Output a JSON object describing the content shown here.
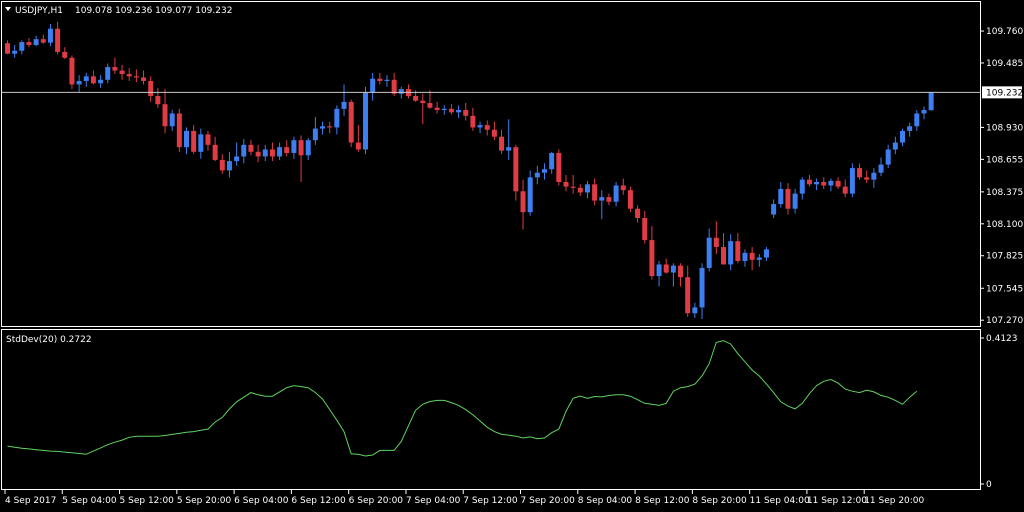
{
  "colors": {
    "background": "#000000",
    "frame": "#ffffff",
    "bull": "#3d7ff0",
    "bear": "#e03c46",
    "indicator": "#5fd35f",
    "price_line": "#c8c8c8",
    "text": "#ffffff"
  },
  "header": {
    "arrow_icon": "triangle-down-icon",
    "symbol": "USDJPY,H1",
    "ohlc": "109.078 109.236 109.077 109.232"
  },
  "indicator_header": {
    "label": "StdDev(20) 0.2722"
  },
  "chart_data": [
    {
      "type": "candlestick",
      "title": "USDJPY,H1",
      "ylim": [
        107.22,
        110.01
      ],
      "y_ticks": [
        "109.760",
        "109.485",
        "109.232",
        "108.930",
        "108.655",
        "108.375",
        "108.100",
        "107.825",
        "107.545",
        "107.270"
      ],
      "current_price": "109.232",
      "current_price_value": 109.232,
      "x_ticks": [
        "4 Sep 2017",
        "5 Sep 04:00",
        "5 Sep 12:00",
        "5 Sep 20:00",
        "6 Sep 04:00",
        "6 Sep 12:00",
        "6 Sep 20:00",
        "7 Sep 04:00",
        "7 Sep 12:00",
        "7 Sep 20:00",
        "8 Sep 04:00",
        "8 Sep 12:00",
        "8 Sep 20:00",
        "11 Sep 04:00",
        "11 Sep 12:00",
        "11 Sep 20:00"
      ],
      "candles": [
        [
          109.655,
          109.68,
          109.56,
          109.565
        ],
        [
          109.565,
          109.64,
          109.53,
          109.59
        ],
        [
          109.59,
          109.68,
          109.56,
          109.665
        ],
        [
          109.665,
          109.7,
          109.62,
          109.64
        ],
        [
          109.64,
          109.72,
          109.63,
          109.69
        ],
        [
          109.69,
          109.73,
          109.65,
          109.66
        ],
        [
          109.66,
          109.82,
          109.63,
          109.78
        ],
        [
          109.78,
          109.84,
          109.56,
          109.58
        ],
        [
          109.58,
          109.62,
          109.52,
          109.53
        ],
        [
          109.53,
          109.55,
          109.26,
          109.3
        ],
        [
          109.3,
          109.38,
          109.23,
          109.33
        ],
        [
          109.33,
          109.4,
          109.28,
          109.37
        ],
        [
          109.37,
          109.42,
          109.3,
          109.31
        ],
        [
          109.31,
          109.38,
          109.27,
          109.34
        ],
        [
          109.34,
          109.48,
          109.31,
          109.45
        ],
        [
          109.45,
          109.53,
          109.39,
          109.42
        ],
        [
          109.42,
          109.47,
          109.34,
          109.39
        ],
        [
          109.39,
          109.44,
          109.33,
          109.37
        ],
        [
          109.37,
          109.43,
          109.32,
          109.36
        ],
        [
          109.36,
          109.42,
          109.3,
          109.33
        ],
        [
          109.33,
          109.37,
          109.15,
          109.2
        ],
        [
          109.2,
          109.27,
          109.1,
          109.13
        ],
        [
          109.13,
          109.26,
          108.88,
          108.94
        ],
        [
          108.94,
          109.08,
          108.9,
          109.05
        ],
        [
          109.05,
          109.09,
          108.72,
          108.76
        ],
        [
          108.76,
          108.93,
          108.7,
          108.9
        ],
        [
          108.9,
          108.95,
          108.7,
          108.72
        ],
        [
          108.72,
          108.92,
          108.66,
          108.87
        ],
        [
          108.87,
          108.9,
          108.73,
          108.78
        ],
        [
          108.78,
          108.85,
          108.64,
          108.65
        ],
        [
          108.65,
          108.7,
          108.53,
          108.56
        ],
        [
          108.56,
          108.72,
          108.5,
          108.64
        ],
        [
          108.64,
          108.8,
          108.6,
          108.68
        ],
        [
          108.68,
          108.83,
          108.62,
          108.78
        ],
        [
          108.78,
          108.82,
          108.69,
          108.72
        ],
        [
          108.72,
          108.78,
          108.63,
          108.68
        ],
        [
          108.68,
          108.78,
          108.64,
          108.74
        ],
        [
          108.74,
          108.8,
          108.64,
          108.68
        ],
        [
          108.68,
          108.8,
          108.65,
          108.76
        ],
        [
          108.76,
          108.82,
          108.68,
          108.71
        ],
        [
          108.71,
          108.85,
          108.66,
          108.82
        ],
        [
          108.82,
          108.86,
          108.46,
          108.69
        ],
        [
          108.69,
          108.84,
          108.65,
          108.82
        ],
        [
          108.82,
          109.02,
          108.78,
          108.92
        ],
        [
          108.92,
          108.98,
          108.87,
          108.94
        ],
        [
          108.94,
          108.98,
          108.88,
          108.93
        ],
        [
          108.93,
          109.12,
          108.87,
          109.09
        ],
        [
          109.09,
          109.3,
          109.03,
          109.15
        ],
        [
          109.15,
          109.17,
          108.76,
          108.8
        ],
        [
          108.8,
          108.95,
          108.72,
          108.74
        ],
        [
          108.74,
          109.28,
          108.7,
          109.23
        ],
        [
          109.23,
          109.4,
          109.16,
          109.35
        ],
        [
          109.35,
          109.4,
          109.3,
          109.33
        ],
        [
          109.33,
          109.38,
          109.28,
          109.34
        ],
        [
          109.34,
          109.4,
          109.2,
          109.22
        ],
        [
          109.22,
          109.28,
          109.18,
          109.26
        ],
        [
          109.26,
          109.3,
          109.18,
          109.2
        ],
        [
          109.2,
          109.25,
          109.15,
          109.16
        ],
        [
          109.16,
          109.22,
          108.96,
          109.14
        ],
        [
          109.14,
          109.25,
          109.09,
          109.1
        ],
        [
          109.1,
          109.15,
          109.05,
          109.08
        ],
        [
          109.08,
          109.12,
          109.04,
          109.09
        ],
        [
          109.09,
          109.13,
          109.04,
          109.06
        ],
        [
          109.06,
          109.12,
          109.01,
          109.08
        ],
        [
          109.08,
          109.14,
          108.99,
          109.03
        ],
        [
          109.03,
          109.1,
          108.9,
          108.93
        ],
        [
          108.93,
          108.98,
          108.88,
          108.95
        ],
        [
          108.95,
          108.99,
          108.86,
          108.91
        ],
        [
          108.91,
          108.98,
          108.82,
          108.85
        ],
        [
          108.85,
          108.91,
          108.7,
          108.73
        ],
        [
          108.73,
          109.0,
          108.65,
          108.76
        ],
        [
          108.76,
          108.78,
          108.3,
          108.38
        ],
        [
          108.38,
          108.48,
          108.05,
          108.2
        ],
        [
          108.2,
          108.56,
          108.17,
          108.5
        ],
        [
          108.5,
          108.6,
          108.44,
          108.54
        ],
        [
          108.54,
          108.62,
          108.48,
          108.57
        ],
        [
          108.57,
          108.72,
          108.53,
          108.71
        ],
        [
          108.71,
          108.74,
          108.43,
          108.46
        ],
        [
          108.46,
          108.52,
          108.38,
          108.42
        ],
        [
          108.42,
          108.52,
          108.36,
          108.41
        ],
        [
          108.41,
          108.44,
          108.34,
          108.37
        ],
        [
          108.37,
          108.47,
          108.32,
          108.44
        ],
        [
          108.44,
          108.49,
          108.26,
          108.3
        ],
        [
          108.3,
          108.39,
          108.14,
          108.33
        ],
        [
          108.33,
          108.36,
          108.26,
          108.29
        ],
        [
          108.29,
          108.46,
          108.25,
          108.43
        ],
        [
          108.43,
          108.49,
          108.35,
          108.39
        ],
        [
          108.39,
          108.42,
          108.2,
          108.23
        ],
        [
          108.23,
          108.26,
          108.11,
          108.15
        ],
        [
          108.15,
          108.21,
          107.93,
          107.96
        ],
        [
          107.96,
          108.08,
          107.62,
          107.65
        ],
        [
          107.65,
          107.78,
          107.56,
          107.75
        ],
        [
          107.75,
          107.8,
          107.67,
          107.68
        ],
        [
          107.68,
          107.76,
          107.56,
          107.74
        ],
        [
          107.74,
          107.76,
          107.56,
          107.64
        ],
        [
          107.64,
          107.74,
          107.3,
          107.33
        ],
        [
          107.33,
          107.42,
          107.29,
          107.38
        ],
        [
          107.38,
          107.76,
          107.28,
          107.72
        ],
        [
          107.72,
          108.06,
          107.69,
          107.98
        ],
        [
          107.98,
          108.12,
          107.84,
          107.9
        ],
        [
          107.9,
          108.02,
          107.75,
          107.75
        ],
        [
          107.75,
          108.01,
          107.7,
          107.95
        ],
        [
          107.95,
          108.02,
          107.76,
          107.78
        ],
        [
          107.78,
          107.88,
          107.73,
          107.85
        ],
        [
          107.85,
          107.9,
          107.7,
          107.79
        ],
        [
          107.79,
          107.84,
          107.73,
          107.81
        ],
        [
          107.81,
          107.9,
          107.78,
          107.88
        ],
        [
          108.18,
          108.31,
          108.15,
          108.27
        ],
        [
          108.27,
          108.46,
          108.24,
          108.4
        ],
        [
          108.4,
          108.45,
          108.18,
          108.23
        ],
        [
          108.23,
          108.4,
          108.19,
          108.36
        ],
        [
          108.36,
          108.5,
          108.31,
          108.48
        ],
        [
          108.48,
          108.52,
          108.42,
          108.44
        ],
        [
          108.44,
          108.49,
          108.39,
          108.46
        ],
        [
          108.46,
          108.5,
          108.4,
          108.43
        ],
        [
          108.43,
          108.49,
          108.38,
          108.47
        ],
        [
          108.47,
          108.5,
          108.4,
          108.42
        ],
        [
          108.42,
          108.48,
          108.33,
          108.36
        ],
        [
          108.36,
          108.62,
          108.33,
          108.58
        ],
        [
          108.58,
          108.62,
          108.48,
          108.5
        ],
        [
          108.5,
          108.56,
          108.45,
          108.48
        ],
        [
          108.48,
          108.58,
          108.41,
          108.54
        ],
        [
          108.54,
          108.67,
          108.51,
          108.61
        ],
        [
          108.61,
          108.78,
          108.58,
          108.74
        ],
        [
          108.74,
          108.85,
          108.7,
          108.8
        ],
        [
          108.8,
          108.92,
          108.77,
          108.9
        ],
        [
          108.9,
          108.97,
          108.85,
          108.94
        ],
        [
          108.94,
          109.08,
          108.9,
          109.05
        ],
        [
          109.05,
          109.11,
          109.0,
          109.08
        ],
        [
          109.078,
          109.236,
          109.077,
          109.232
        ]
      ]
    },
    {
      "type": "line",
      "title": "StdDev(20) 0.2722",
      "ylim": [
        0,
        0.4123
      ],
      "y_ticks": [
        "0.4123",
        "0"
      ],
      "series": [
        {
          "values": [
            0.107,
            0.104,
            0.101,
            0.099,
            0.097,
            0.095,
            0.093,
            0.092,
            0.09,
            0.088,
            0.086,
            0.084,
            0.093,
            0.102,
            0.111,
            0.118,
            0.124,
            0.132,
            0.135,
            0.135,
            0.135,
            0.135,
            0.137,
            0.14,
            0.143,
            0.146,
            0.148,
            0.152,
            0.155,
            0.175,
            0.188,
            0.212,
            0.232,
            0.245,
            0.258,
            0.252,
            0.248,
            0.248,
            0.26,
            0.272,
            0.278,
            0.275,
            0.272,
            0.258,
            0.24,
            0.21,
            0.18,
            0.148,
            0.085,
            0.084,
            0.079,
            0.082,
            0.095,
            0.095,
            0.095,
            0.12,
            0.165,
            0.208,
            0.225,
            0.233,
            0.236,
            0.236,
            0.23,
            0.222,
            0.21,
            0.195,
            0.178,
            0.16,
            0.148,
            0.14,
            0.138,
            0.135,
            0.13,
            0.133,
            0.128,
            0.13,
            0.145,
            0.155,
            0.205,
            0.242,
            0.248,
            0.242,
            0.247,
            0.246,
            0.25,
            0.252,
            0.252,
            0.248,
            0.238,
            0.228,
            0.225,
            0.222,
            0.228,
            0.262,
            0.272,
            0.275,
            0.282,
            0.305,
            0.34,
            0.4,
            0.405,
            0.395,
            0.368,
            0.345,
            0.322,
            0.305,
            0.282,
            0.258,
            0.232,
            0.22,
            0.212,
            0.228,
            0.255,
            0.278,
            0.29,
            0.295,
            0.285,
            0.268,
            0.262,
            0.258,
            0.265,
            0.26,
            0.25,
            0.245,
            0.236,
            0.225,
            0.245,
            0.262
          ]
        }
      ]
    }
  ]
}
